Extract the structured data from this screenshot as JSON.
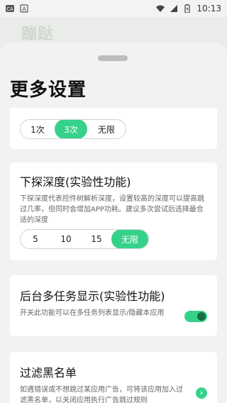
{
  "status_bar": {
    "time": "10:13"
  },
  "background_title": "蹦跶",
  "sheet": {
    "title": "更多设置"
  },
  "click_times": {
    "options": [
      "1次",
      "3次",
      "无限"
    ],
    "selected_index": 1
  },
  "depth": {
    "title": "下探深度(实验性功能)",
    "desc": "下探深度代表控件树解析深度，设置较高的深度可以提高跳过几率，但同时会增加APP功耗。建议多次尝试后选择最合适的深度",
    "options": [
      "5",
      "10",
      "15",
      "无限"
    ],
    "selected_index": 3
  },
  "multitask": {
    "title": "后台多任务显示(实验性功能)",
    "desc": "开关此功能可以在多任务列表显示/隐藏本应用",
    "enabled": true
  },
  "blacklist": {
    "title": "过滤黑名单",
    "desc": "如遇错误或不想跳过某应用广告，可将该应用加入过滤黑名单，以关闭应用执行广告跳过规则"
  },
  "colors": {
    "accent": "#36d28a",
    "knob": "#1a6e45"
  },
  "icons": [
    "app-badge-icon",
    "a-icon",
    "wifi-icon",
    "signal-icon",
    "battery-icon",
    "chevron-right-icon"
  ]
}
